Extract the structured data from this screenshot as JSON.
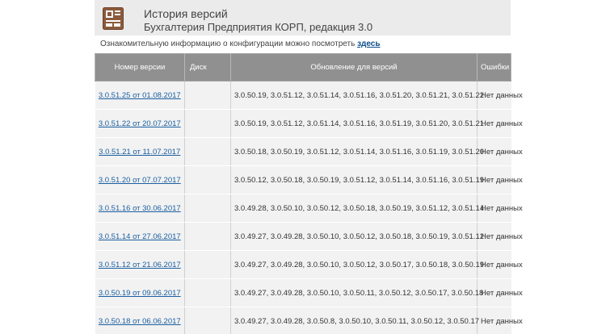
{
  "header": {
    "title": "История версий",
    "subtitle": "Бухгалтерия Предприятия КОРП, редакция 3.0"
  },
  "info": {
    "text": "Ознакомительную информацию о конфигурации можно посмотреть ",
    "link": "здесь"
  },
  "table": {
    "columns": [
      "Номер версии",
      "Диск",
      "Обновление для версий",
      "Ошибки"
    ],
    "rows": [
      {
        "version": "3.0.51.25 от 01.08.2017",
        "disk": "",
        "updates": "3.0.50.19, 3.0.51.12, 3.0.51.14, 3.0.51.16, 3.0.51.20, 3.0.51.21, 3.0.51.22",
        "errors": "Нет данных"
      },
      {
        "version": "3.0.51.22 от 20.07.2017",
        "disk": "",
        "updates": "3.0.50.19, 3.0.51.12, 3.0.51.14, 3.0.51.16, 3.0.51.19, 3.0.51.20, 3.0.51.21",
        "errors": "Нет данных"
      },
      {
        "version": "3.0.51.21 от 11.07.2017",
        "disk": "",
        "updates": "3.0.50.18, 3.0.50.19, 3.0.51.12, 3.0.51.14, 3.0.51.16, 3.0.51.19, 3.0.51.20",
        "errors": "Нет данных"
      },
      {
        "version": "3.0.51.20 от 07.07.2017",
        "disk": "",
        "updates": "3.0.50.12, 3.0.50.18, 3.0.50.19, 3.0.51.12, 3.0.51.14, 3.0.51.16, 3.0.51.19",
        "errors": "Нет данных"
      },
      {
        "version": "3.0.51.16 от 30.06.2017",
        "disk": "",
        "updates": "3.0.49.28, 3.0.50.10, 3.0.50.12, 3.0.50.18, 3.0.50.19, 3.0.51.12, 3.0.51.14",
        "errors": "Нет данных"
      },
      {
        "version": "3.0.51.14 от 27.06.2017",
        "disk": "",
        "updates": "3.0.49.27, 3.0.49.28, 3.0.50.10, 3.0.50.12, 3.0.50.18, 3.0.50.19, 3.0.51.12",
        "errors": "Нет данных"
      },
      {
        "version": "3.0.51.12 от 21.06.2017",
        "disk": "",
        "updates": "3.0.49.27, 3.0.49.28, 3.0.50.10, 3.0.50.12, 3.0.50.17, 3.0.50.18, 3.0.50.19",
        "errors": "Нет данных"
      },
      {
        "version": "3.0.50.19 от 09.06.2017",
        "disk": "",
        "updates": "3.0.49.27, 3.0.49.28, 3.0.50.10, 3.0.50.11, 3.0.50.12, 3.0.50.17, 3.0.50.18",
        "errors": "Нет данных"
      },
      {
        "version": "3.0.50.18 от 06.06.2017",
        "disk": "",
        "updates": "3.0.49.27, 3.0.49.28, 3.0.50.8, 3.0.50.10, 3.0.50.11, 3.0.50.12, 3.0.50.17",
        "errors": "Нет данных"
      }
    ]
  },
  "colors": {
    "header_bg": "#ebebeb",
    "table_head_bg": "#909090",
    "row_bg": "#f2f2f2",
    "link": "#1a5fa0",
    "logo_brown": "#8b5a3c"
  }
}
